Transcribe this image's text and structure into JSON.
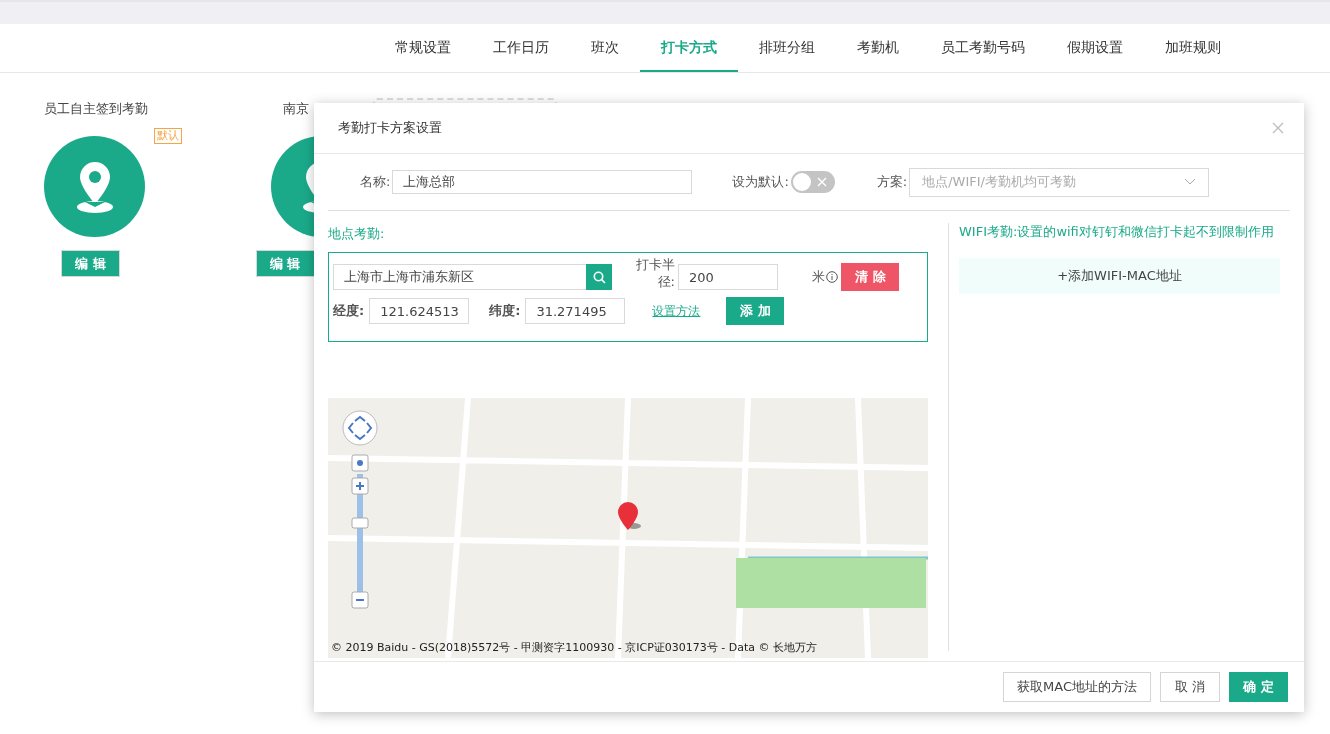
{
  "top_tabs": [
    {
      "label": "常规设置",
      "selected": false
    },
    {
      "label": "工作日历",
      "selected": false
    },
    {
      "label": "班次",
      "selected": false
    },
    {
      "label": "打卡方式",
      "selected": true
    },
    {
      "label": "排班分组",
      "selected": false
    },
    {
      "label": "考勤机",
      "selected": false
    },
    {
      "label": "员工考勤号码",
      "selected": false
    },
    {
      "label": "假期设置",
      "selected": false
    },
    {
      "label": "加班规则",
      "selected": false
    }
  ],
  "schemes": [
    {
      "title": "员工自主签到考勤",
      "is_default": true,
      "default_badge": "默认",
      "edit_button": "编 辑"
    },
    {
      "title": "南京",
      "is_default": false,
      "edit_button": "编 辑"
    }
  ],
  "dialog": {
    "title": "考勤打卡方案设置",
    "name_label": "名称:",
    "name_value": "上海总部",
    "default_label": "设为默认:",
    "default_on": false,
    "plan_label": "方案:",
    "plan_placeholder": "地点/WIFI/考勤机均可考勤",
    "location": {
      "heading": "地点考勤:",
      "address_value": "上海市上海市浦东新区",
      "radius_label": "打卡半径:",
      "radius_value": "200",
      "radius_unit": "米",
      "clear_button": "清 除",
      "lng_label": "经度:",
      "lng_value": "121.624513",
      "lat_label": "纬度:",
      "lat_value": "31.271495",
      "help_link": "设置方法",
      "add_button": "添 加"
    },
    "map": {
      "copyright": "© 2019 Baidu - GS(2018)5572号 - 甲测资字1100930 - 京ICP证030173号 - Data © 长地万方"
    },
    "wifi": {
      "heading": "WIFI考勤:设置的wifi对钉钉和微信打卡起不到限制作用",
      "add_button": "+添加WIFI-MAC地址"
    },
    "footer": {
      "help_button": "获取MAC地址的方法",
      "cancel_button": "取 消",
      "ok_button": "确 定"
    }
  }
}
